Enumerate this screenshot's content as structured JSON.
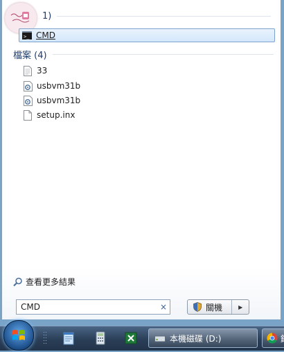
{
  "groups": {
    "programs": {
      "header": "1)",
      "items": [
        {
          "label": "CMD",
          "icon": "cmd-icon"
        }
      ]
    },
    "files": {
      "header": "檔案 (4)",
      "items": [
        {
          "label": "33",
          "icon": "text-file-icon"
        },
        {
          "label": "usbvm31b",
          "icon": "settings-file-icon"
        },
        {
          "label": "usbvm31b",
          "icon": "settings-file-icon"
        },
        {
          "label": "setup.inx",
          "icon": "blank-file-icon"
        }
      ]
    }
  },
  "see_more": {
    "label": "查看更多結果",
    "icon": "magnifier-icon"
  },
  "search": {
    "value": "CMD",
    "clear_icon": "×"
  },
  "shutdown": {
    "label": "關機",
    "arrow": "▶",
    "icon": "shield-icon"
  },
  "taskbar": {
    "drive_window": {
      "label": "本機磁碟 (D:)",
      "icon": "drive-icon"
    },
    "chrome_window": {
      "label": "錄",
      "icon": "chrome-icon"
    }
  },
  "colors": {
    "accent": "#1e3c6e",
    "selection_border": "#7da2ce",
    "taskbar": "#2a3e57"
  }
}
